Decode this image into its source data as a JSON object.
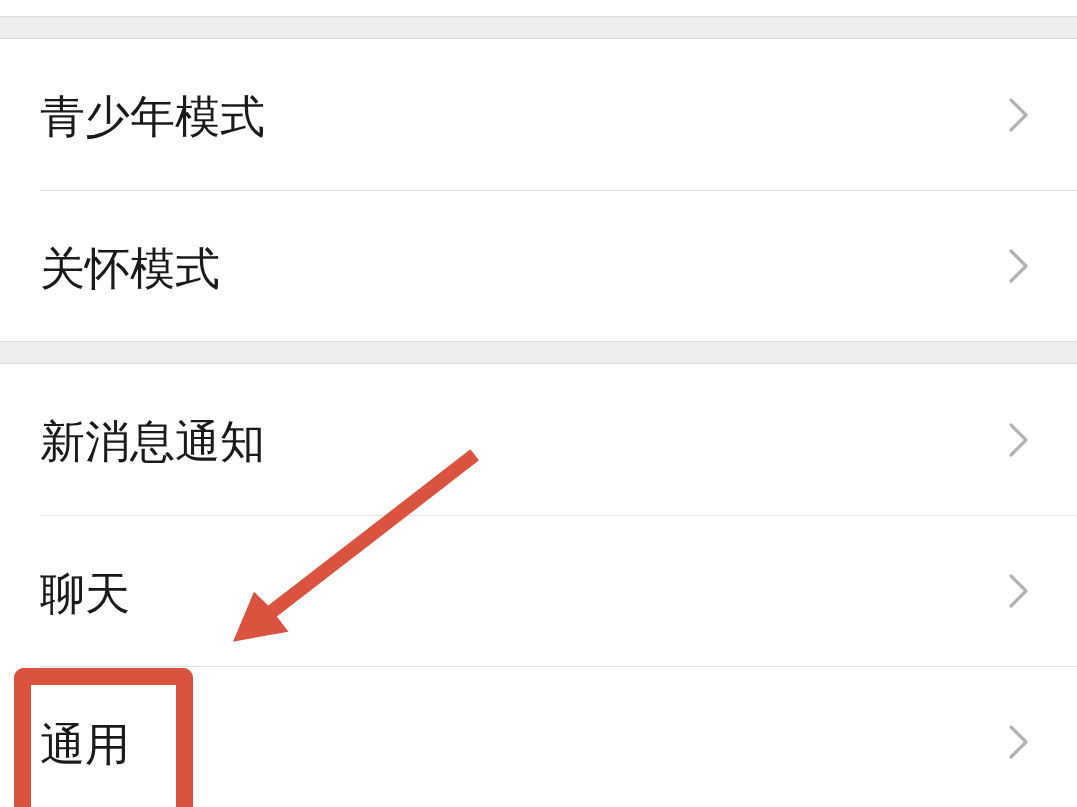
{
  "groups": [
    {
      "items": [
        {
          "label": "青少年模式",
          "highlighted": false
        },
        {
          "label": "关怀模式",
          "highlighted": false
        }
      ]
    },
    {
      "items": [
        {
          "label": "新消息通知",
          "highlighted": false
        },
        {
          "label": "聊天",
          "highlighted": false
        },
        {
          "label": "通用",
          "highlighted": true
        }
      ]
    }
  ],
  "annotation_arrow": true
}
